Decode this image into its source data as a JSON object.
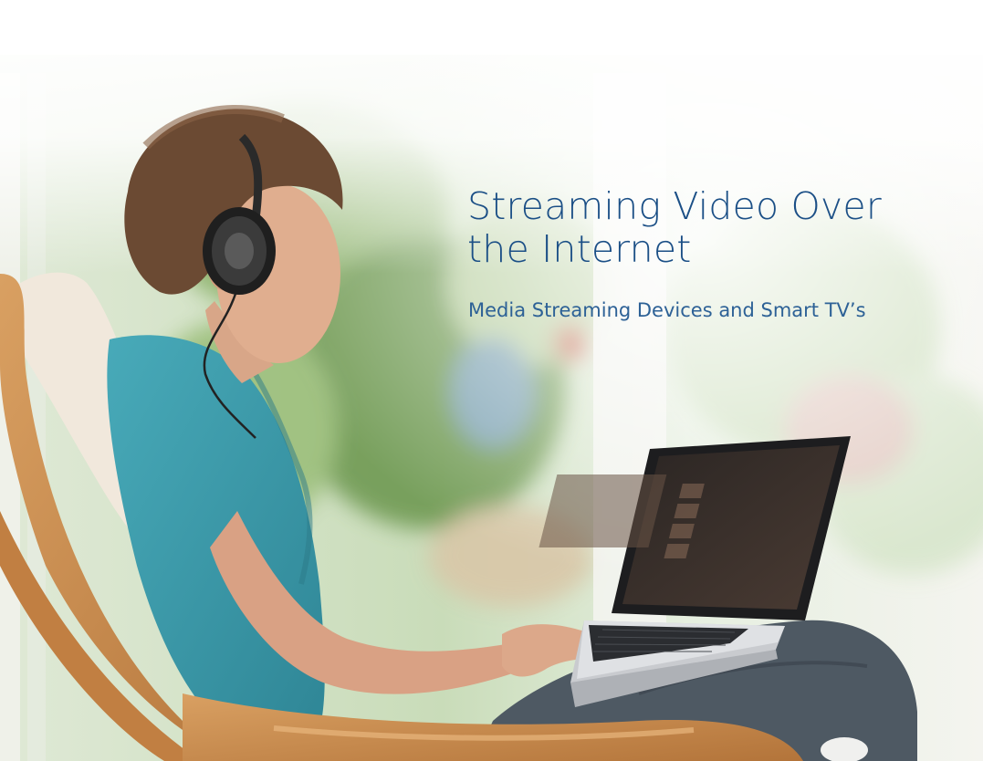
{
  "hero": {
    "title_line1": "Streaming Video Over",
    "title_line2": "the Internet",
    "subtitle": "Media Streaming Devices and Smart TV’s"
  },
  "colors": {
    "title": "#1b4f86",
    "subtitle": "#2d6196",
    "shirt": "#3b98a9",
    "chair_wood": "#c98a4a",
    "cushion": "#f2ebe0"
  }
}
